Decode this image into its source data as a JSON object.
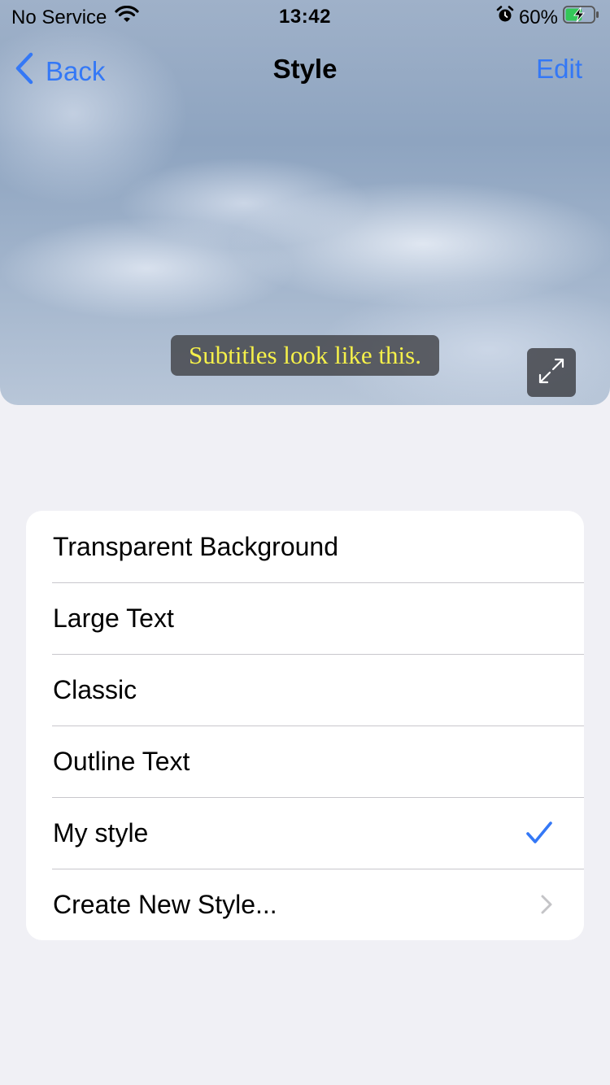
{
  "status_bar": {
    "carrier": "No Service",
    "time": "13:42",
    "battery_percent": "60%",
    "battery_level": 0.6,
    "icons": [
      "wifi-icon",
      "alarm-icon",
      "battery-charging-icon"
    ]
  },
  "nav": {
    "back_label": "Back",
    "title": "Style",
    "edit_label": "Edit"
  },
  "preview": {
    "subtitle_text": "Subtitles look like this.",
    "subtitle_color": "#f5f04a",
    "expand_icon": "expand-icon"
  },
  "styles_list": {
    "items": [
      {
        "label": "Transparent Background"
      },
      {
        "label": "Large Text"
      },
      {
        "label": "Classic"
      },
      {
        "label": "Outline Text"
      },
      {
        "label": "My style",
        "selected": true
      },
      {
        "label": "Create New Style..."
      }
    ]
  },
  "colors": {
    "accent": "#3478f6",
    "background": "#f0f0f5",
    "separator": "#c8c7cc"
  }
}
